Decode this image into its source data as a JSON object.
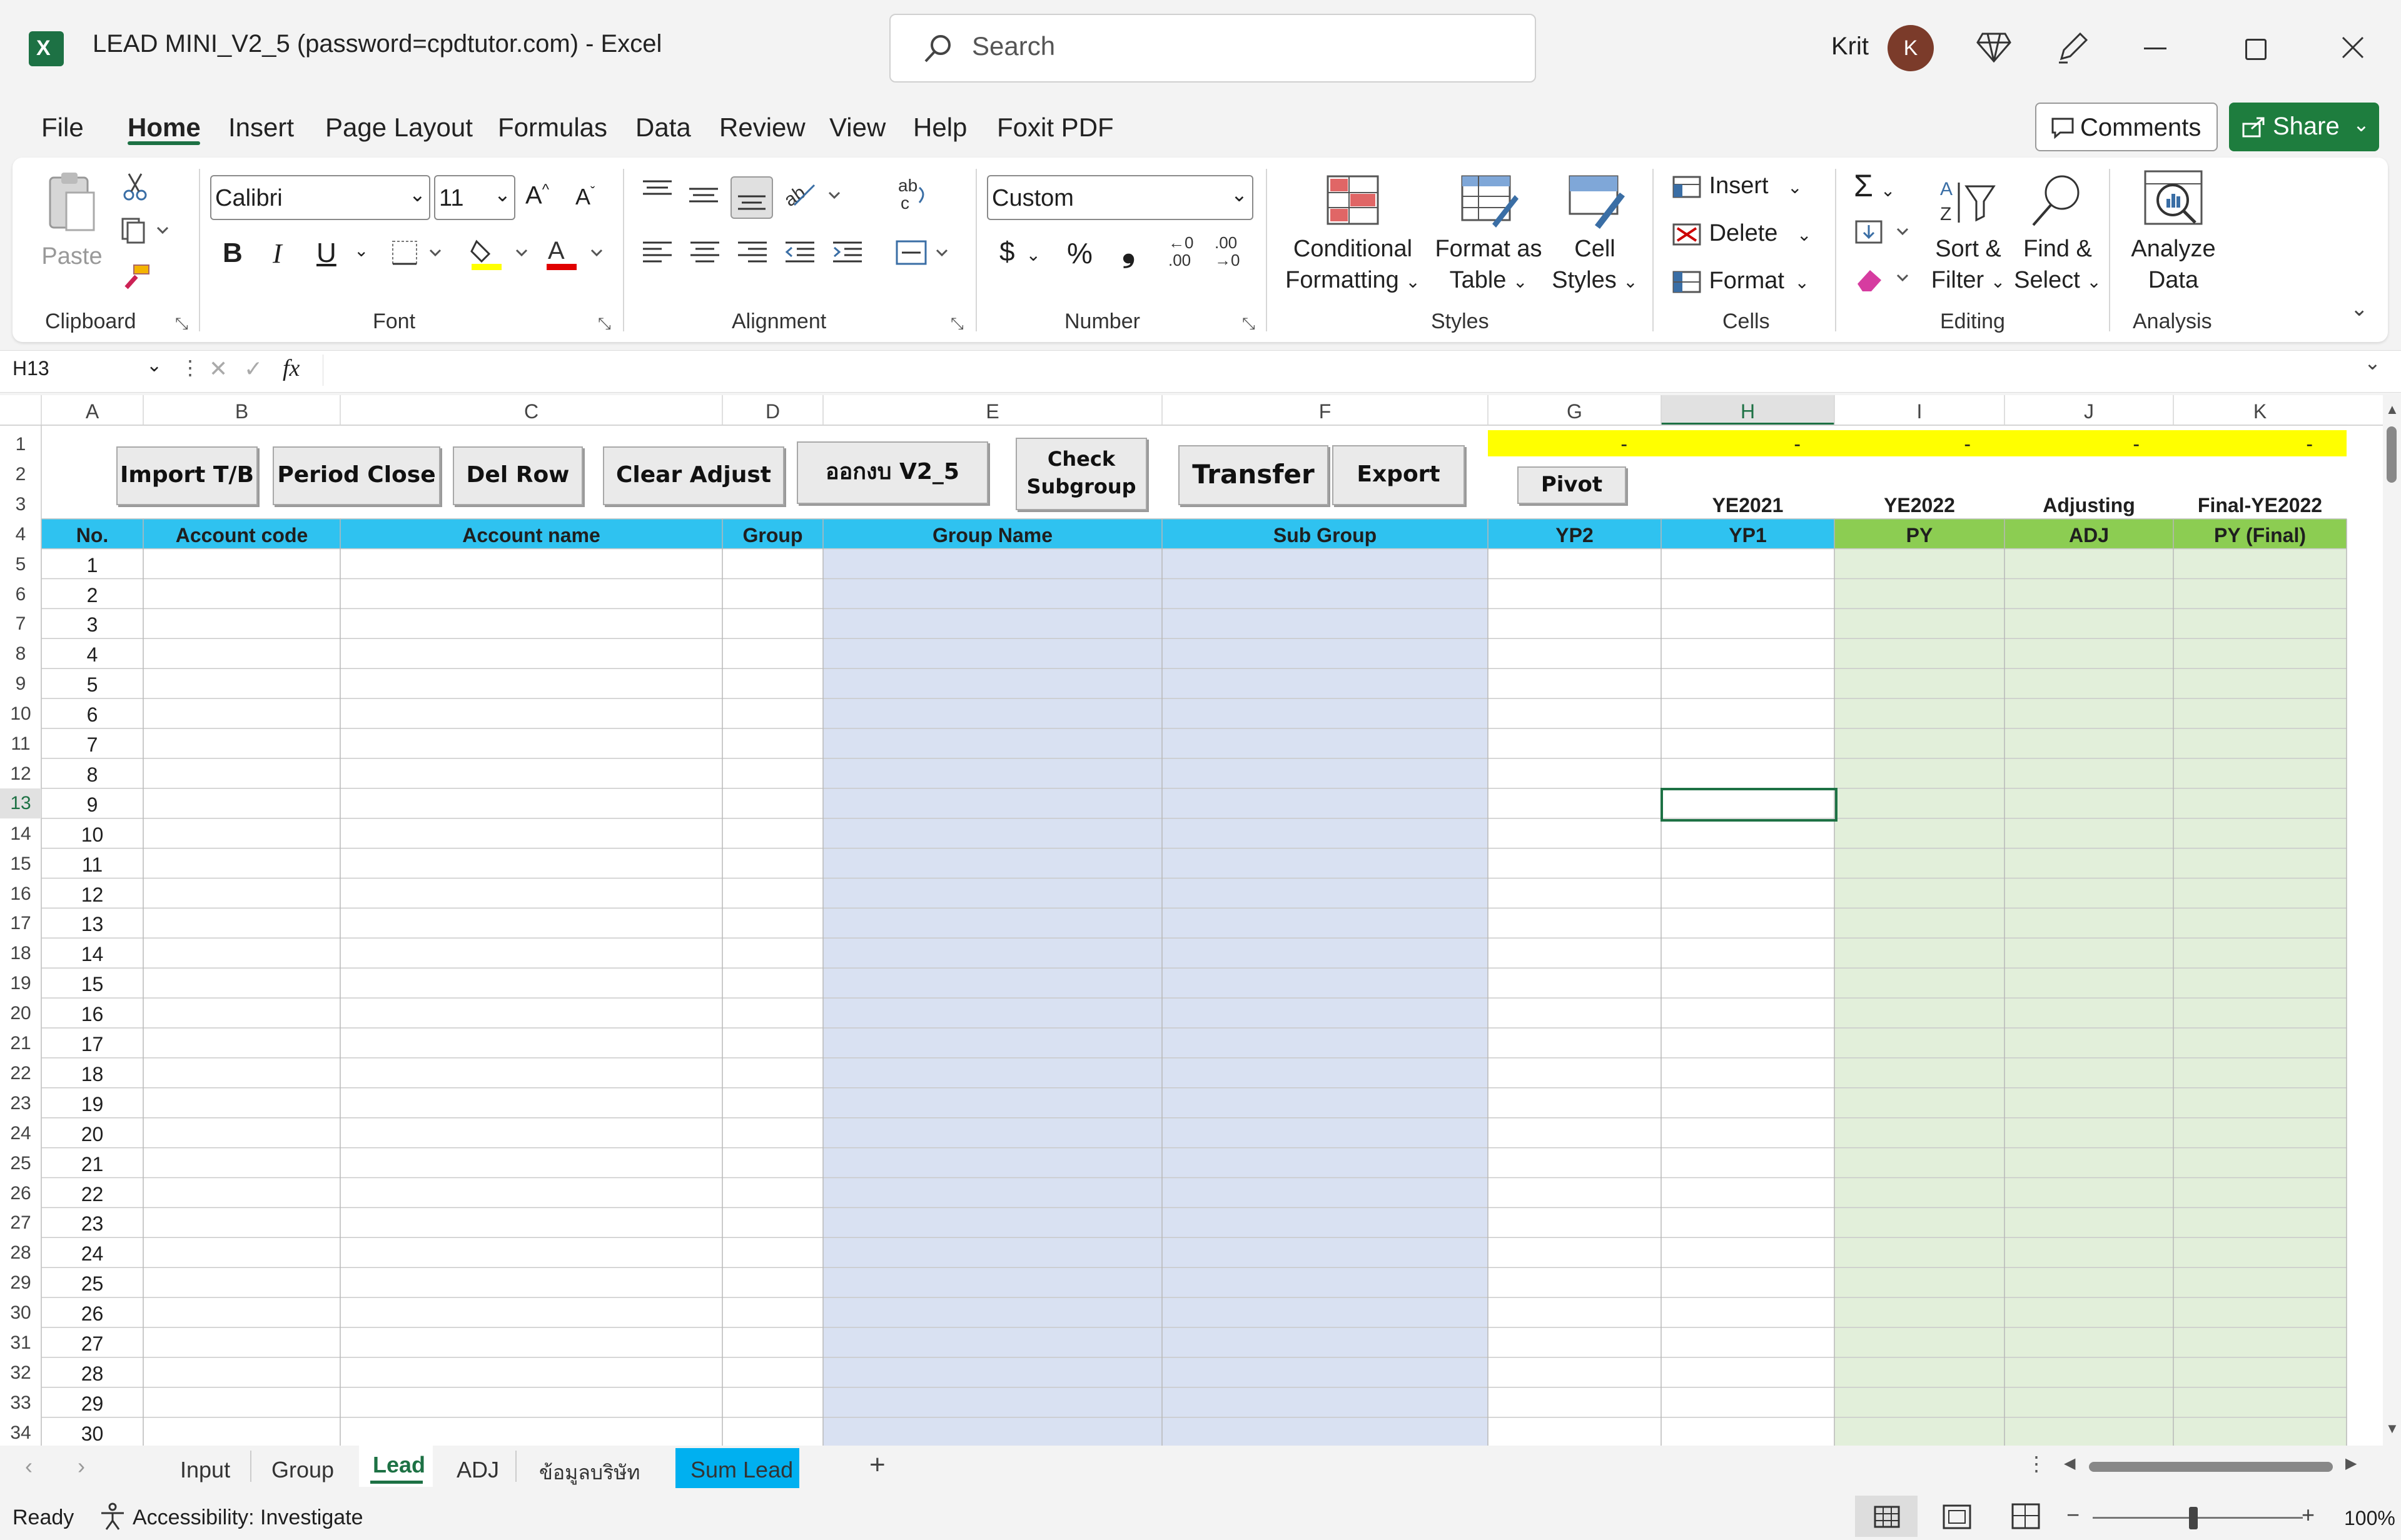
{
  "window": {
    "title": "LEAD MINI_V2_5 (password=cpdtutor.com)  -  Excel",
    "search_placeholder": "Search",
    "user_name": "Krit",
    "avatar_initial": "K"
  },
  "ribbon_tabs": [
    "File",
    "Home",
    "Insert",
    "Page Layout",
    "Formulas",
    "Data",
    "Review",
    "View",
    "Help",
    "Foxit PDF"
  ],
  "active_tab": "Home",
  "top_buttons": {
    "comments": "Comments",
    "share": "Share"
  },
  "ribbon": {
    "clipboard": {
      "label": "Clipboard",
      "paste": "Paste"
    },
    "font": {
      "label": "Font",
      "font_name": "Calibri",
      "font_size": "11",
      "bold": "B",
      "italic": "I",
      "underline": "U",
      "grow": "A^",
      "shrink": "Aˇ"
    },
    "alignment": {
      "label": "Alignment"
    },
    "number": {
      "label": "Number",
      "format": "Custom",
      "currency": "$",
      "percent": "%",
      "comma": "❟",
      "inc_decimal": ".00",
      "dec_decimal": ".00"
    },
    "styles": {
      "label": "Styles",
      "conditional_formatting": [
        "Conditional",
        "Formatting"
      ],
      "format_as_table": [
        "Format as",
        "Table"
      ],
      "cell_styles": [
        "Cell",
        "Styles"
      ]
    },
    "cells": {
      "label": "Cells",
      "insert": "Insert",
      "delete": "Delete",
      "format": "Format"
    },
    "editing": {
      "label": "Editing",
      "autosum": "Σ",
      "sort_filter": [
        "Sort &",
        "Filter"
      ],
      "find_select": [
        "Find &",
        "Select"
      ]
    },
    "analysis": {
      "label": "Analysis",
      "analyze_data": [
        "Analyze",
        "Data"
      ]
    }
  },
  "formula_bar": {
    "name_box": "H13",
    "fx": "fx",
    "formula": ""
  },
  "columns": [
    "A",
    "B",
    "C",
    "D",
    "E",
    "F",
    "G",
    "H",
    "I",
    "J",
    "K"
  ],
  "active_column": "H",
  "active_row": "13",
  "macro_buttons": {
    "import_tb": "Import T/B",
    "period_close": "Period Close",
    "del_row": "Del Row",
    "clear_adjust": "Clear Adjust",
    "print_v2": "ออกงบ V2_5",
    "check_subgroup": [
      "Check",
      "Subgroup"
    ],
    "transfer": "Transfer",
    "export": "Export",
    "pivot": "Pivot"
  },
  "row1_dashes": [
    "-",
    "-",
    "-",
    "-",
    "-"
  ],
  "row3_labels": {
    "H": "YE2021",
    "I": "YE2022",
    "J": "Adjusting",
    "K": "Final-YE2022"
  },
  "table_headers": {
    "A": "No.",
    "B": "Account code",
    "C": "Account name",
    "D": "Group",
    "E": "Group Name",
    "F": "Sub Group",
    "G": "YP2",
    "H": "YP1",
    "I": "PY",
    "J": "ADJ",
    "K": "PY (Final)"
  },
  "visible_rows": [
    {
      "row": "1",
      "no": ""
    },
    {
      "row": "2",
      "no": ""
    },
    {
      "row": "3",
      "no": ""
    },
    {
      "row": "4",
      "no": ""
    },
    {
      "row": "5",
      "no": "1"
    },
    {
      "row": "6",
      "no": "2"
    },
    {
      "row": "7",
      "no": "3"
    },
    {
      "row": "8",
      "no": "4"
    },
    {
      "row": "9",
      "no": "5"
    },
    {
      "row": "10",
      "no": "6"
    },
    {
      "row": "11",
      "no": "7"
    },
    {
      "row": "12",
      "no": "8"
    },
    {
      "row": "13",
      "no": "9"
    },
    {
      "row": "14",
      "no": "10"
    },
    {
      "row": "15",
      "no": "11"
    },
    {
      "row": "16",
      "no": "12"
    },
    {
      "row": "17",
      "no": "13"
    },
    {
      "row": "18",
      "no": "14"
    },
    {
      "row": "19",
      "no": "15"
    },
    {
      "row": "20",
      "no": "16"
    },
    {
      "row": "21",
      "no": "17"
    },
    {
      "row": "22",
      "no": "18"
    },
    {
      "row": "23",
      "no": "19"
    },
    {
      "row": "24",
      "no": "20"
    },
    {
      "row": "25",
      "no": "21"
    },
    {
      "row": "26",
      "no": "22"
    },
    {
      "row": "27",
      "no": "23"
    },
    {
      "row": "28",
      "no": "24"
    },
    {
      "row": "29",
      "no": "25"
    },
    {
      "row": "30",
      "no": "26"
    },
    {
      "row": "31",
      "no": "27"
    },
    {
      "row": "32",
      "no": "28"
    },
    {
      "row": "33",
      "no": "29"
    },
    {
      "row": "34",
      "no": "30"
    }
  ],
  "sheet_tabs": [
    "Input",
    "Group",
    "Lead",
    "ADJ",
    "ข้อมูลบริษัท",
    "Sum Lead"
  ],
  "active_sheet": "Lead",
  "status": {
    "ready": "Ready",
    "accessibility": "Accessibility: Investigate",
    "zoom": "100%"
  },
  "colors": {
    "header_blue": "#2fc2f0",
    "header_green": "#8ccd52",
    "group_fill": "#d9e1f2",
    "prior_fill": "#e2efda",
    "yellow": "#ffff00",
    "share_green": "#1e7d3e",
    "sum_lead_tab": "#00b0f0",
    "avatar": "#7b3b2a"
  }
}
